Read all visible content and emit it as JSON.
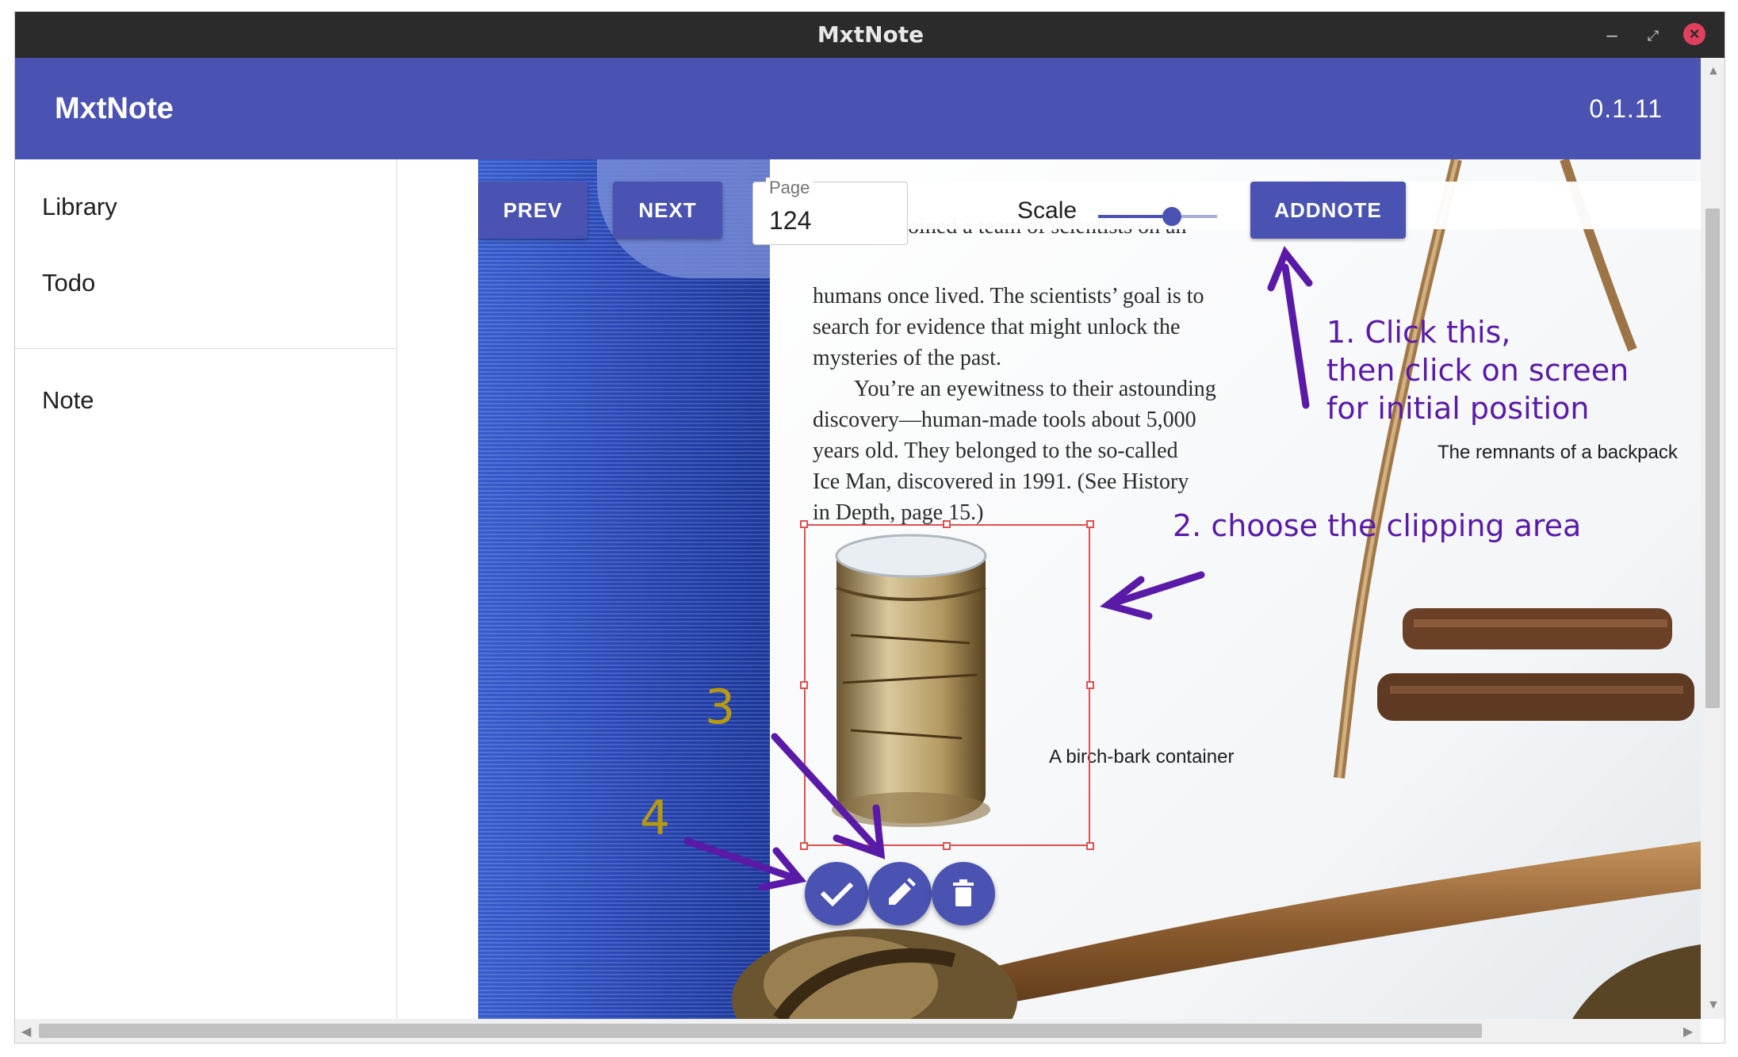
{
  "window": {
    "title": "MxtNote"
  },
  "appbar": {
    "title": "MxtNote",
    "version": "0.1.11"
  },
  "sidebar": {
    "items": [
      {
        "label": "Library"
      },
      {
        "label": "Todo"
      },
      {
        "label": "Note"
      }
    ]
  },
  "toolbar": {
    "prev_label": "PREV",
    "next_label": "NEXT",
    "page_label": "Page",
    "page_value": "124",
    "scale_label": "Scale",
    "scale_value": 0.62,
    "addnote_label": "ADDNOTE"
  },
  "book": {
    "top_line": "You have joined a team of scientists on an",
    "paragraph1": [
      "humans once lived. The scientists’ goal is to",
      "search for evidence that might unlock the",
      "mysteries of the past."
    ],
    "paragraph2": [
      "You’re an eyewitness to their astounding",
      "discovery—human-made tools about 5,000",
      "years old. They belonged to the so-called",
      "Ice Man, discovered in 1991. (See History",
      "in Depth, page 15.)"
    ],
    "caption_backpack": "The remnants of a backpack",
    "caption_container": "A birch-bark container"
  },
  "annotations": {
    "step1": [
      "1. Click this,",
      "then click on screen",
      "for initial position"
    ],
    "step2": "2. choose the clipping area",
    "step3": "3",
    "step4": "4"
  },
  "colors": {
    "primary": "#4a52b2",
    "annotation": "#5a1aa8",
    "number": "#b89a10",
    "clip_border": "#e05050"
  },
  "icons": {
    "confirm": "check-icon",
    "edit": "pencil-icon",
    "delete": "trash-icon"
  }
}
